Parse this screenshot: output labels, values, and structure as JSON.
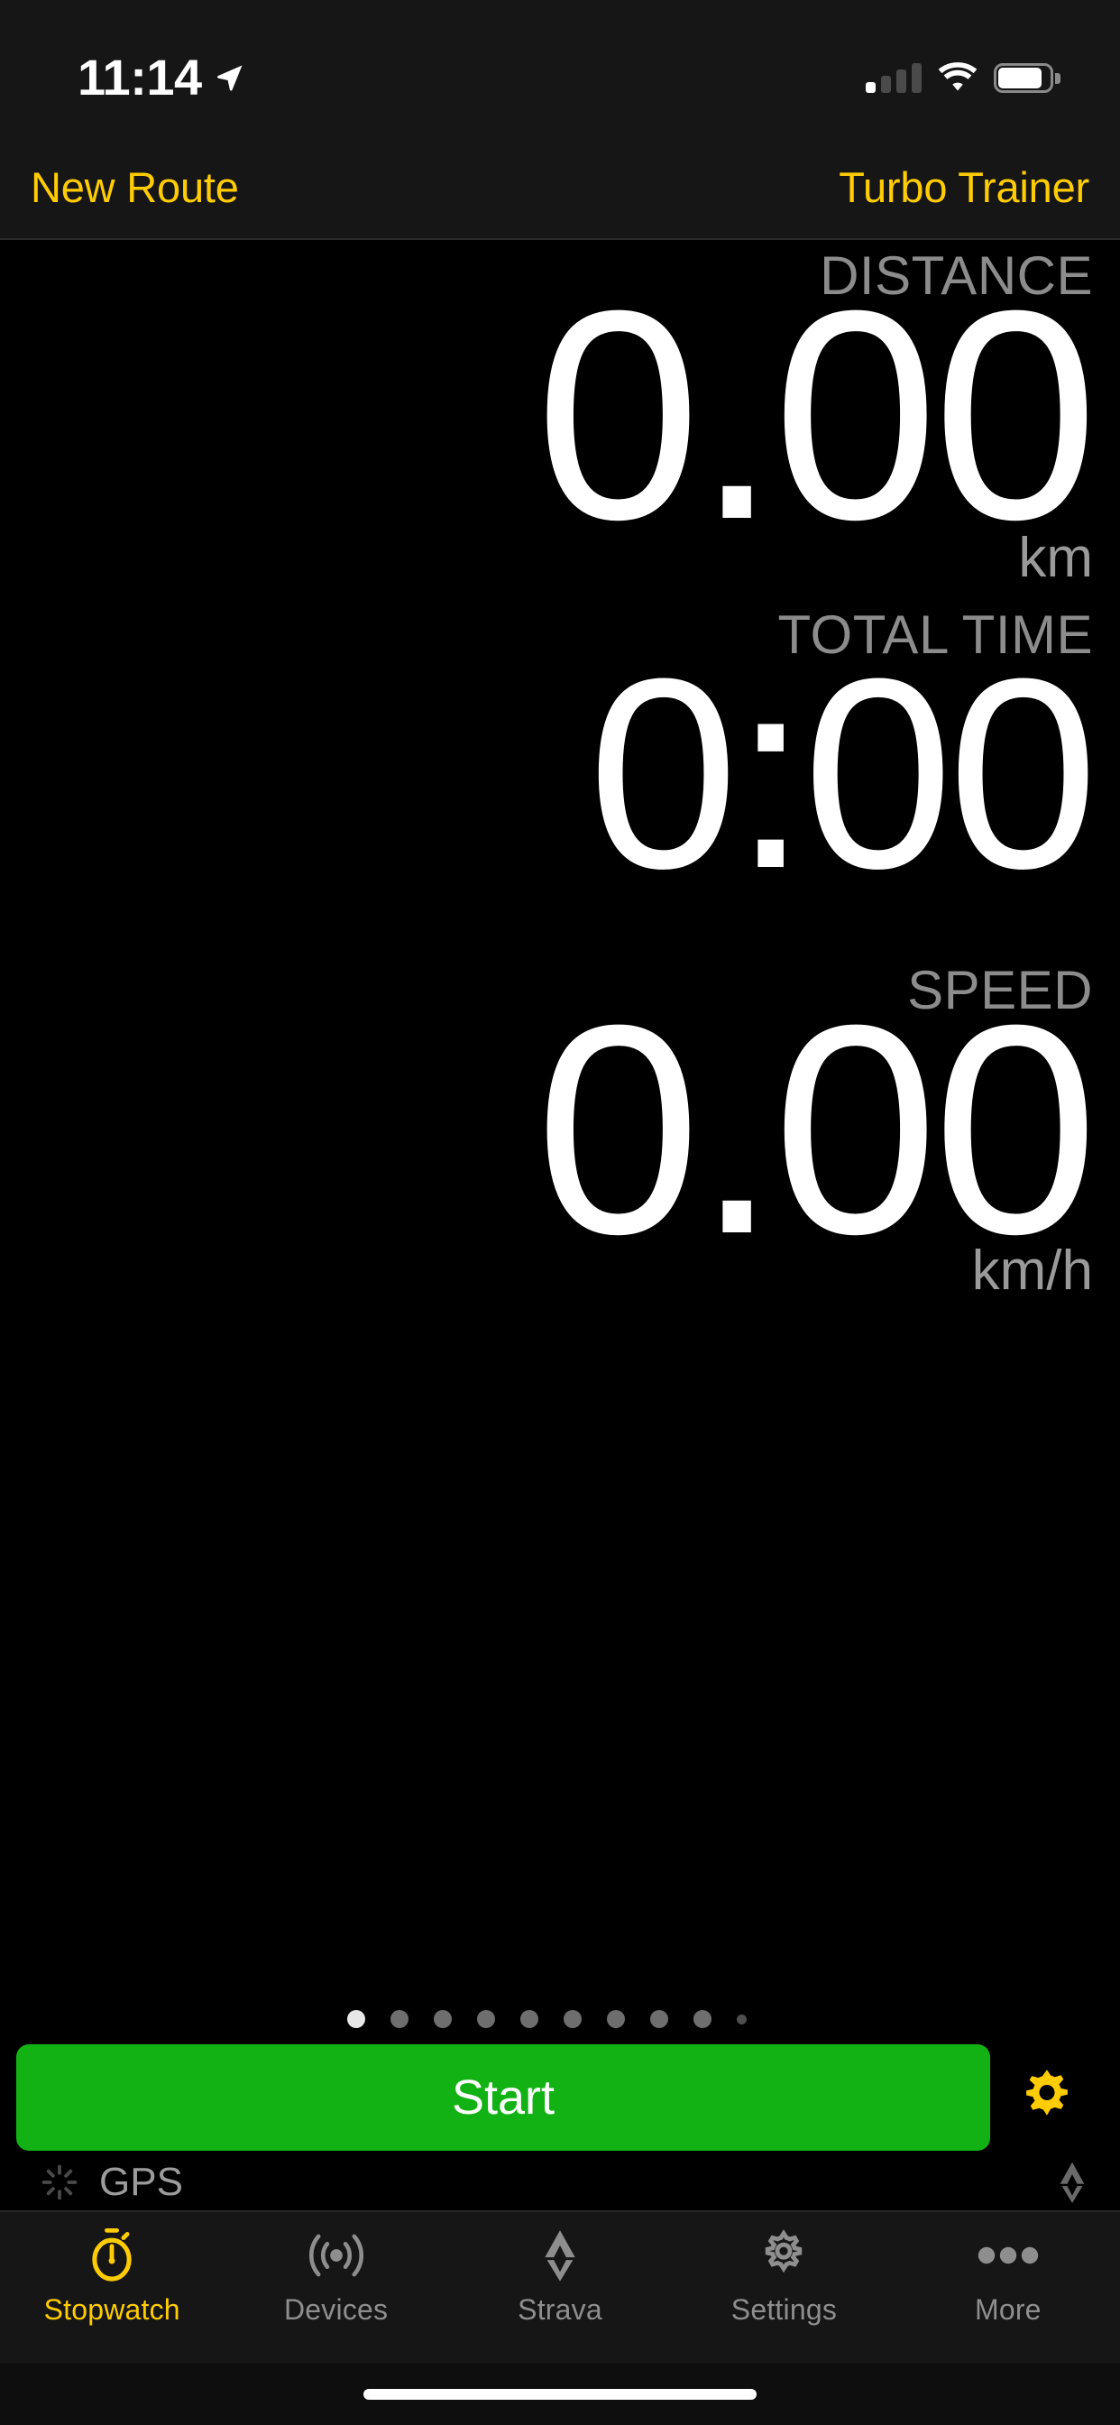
{
  "status_bar": {
    "time": "11:14",
    "location_icon": "location-arrow-icon",
    "cellular_icon": "cellular-signal-icon",
    "cellular_bars_filled": 1,
    "wifi_icon": "wifi-icon",
    "battery_icon": "battery-icon",
    "battery_level_percent": 80
  },
  "nav_bar": {
    "left_label": "New Route",
    "right_label": "Turbo Trainer",
    "accent_color": "#FFCC00"
  },
  "metrics": [
    {
      "label": "DISTANCE",
      "value": "0.00",
      "unit": "km"
    },
    {
      "label": "TOTAL TIME",
      "value": "0:00",
      "unit": ""
    },
    {
      "label": "SPEED",
      "value": "0.00",
      "unit": "km/h"
    }
  ],
  "page_dots": {
    "count": 10,
    "active_index": 0
  },
  "actions": {
    "start_label": "Start",
    "start_color": "#13B214",
    "settings_icon": "gear-icon",
    "settings_color": "#FFCC00"
  },
  "gps_status": {
    "spinner_icon": "activity-spinner-icon",
    "label": "GPS",
    "strava_icon": "strava-chevron-icon"
  },
  "tab_bar": {
    "active_index": 0,
    "accent_color": "#FFCC00",
    "inactive_color": "#8e8e8e",
    "items": [
      {
        "label": "Stopwatch",
        "icon": "stopwatch-icon"
      },
      {
        "label": "Devices",
        "icon": "broadcast-icon"
      },
      {
        "label": "Strava",
        "icon": "strava-chevron-icon"
      },
      {
        "label": "Settings",
        "icon": "gear-icon"
      },
      {
        "label": "More",
        "icon": "ellipsis-icon"
      }
    ]
  },
  "home_indicator": "home-indicator-bar"
}
